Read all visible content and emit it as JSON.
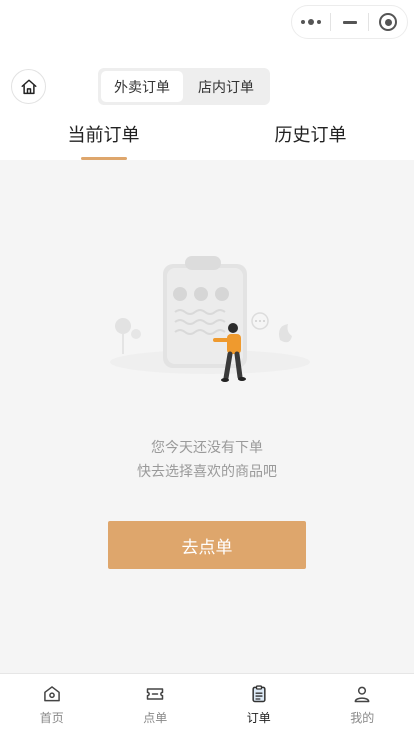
{
  "order_type_switch": {
    "options": [
      "外卖订单",
      "店内订单"
    ],
    "selected_index": 0
  },
  "tabs": [
    {
      "label": "当前订单",
      "active": true
    },
    {
      "label": "历史订单",
      "active": false
    }
  ],
  "empty_state": {
    "line1": "您今天还没有下单",
    "line2": "快去选择喜欢的商品吧",
    "button_label": "去点单"
  },
  "tabbar": [
    {
      "label": "首页",
      "icon": "home-icon",
      "active": false
    },
    {
      "label": "点单",
      "icon": "ticket-icon",
      "active": false
    },
    {
      "label": "订单",
      "icon": "clipboard-icon",
      "active": true
    },
    {
      "label": "我的",
      "icon": "user-icon",
      "active": false
    }
  ],
  "colors": {
    "accent": "#dea66c",
    "background": "#f5f5f5",
    "text_muted": "#9a9a9a"
  }
}
